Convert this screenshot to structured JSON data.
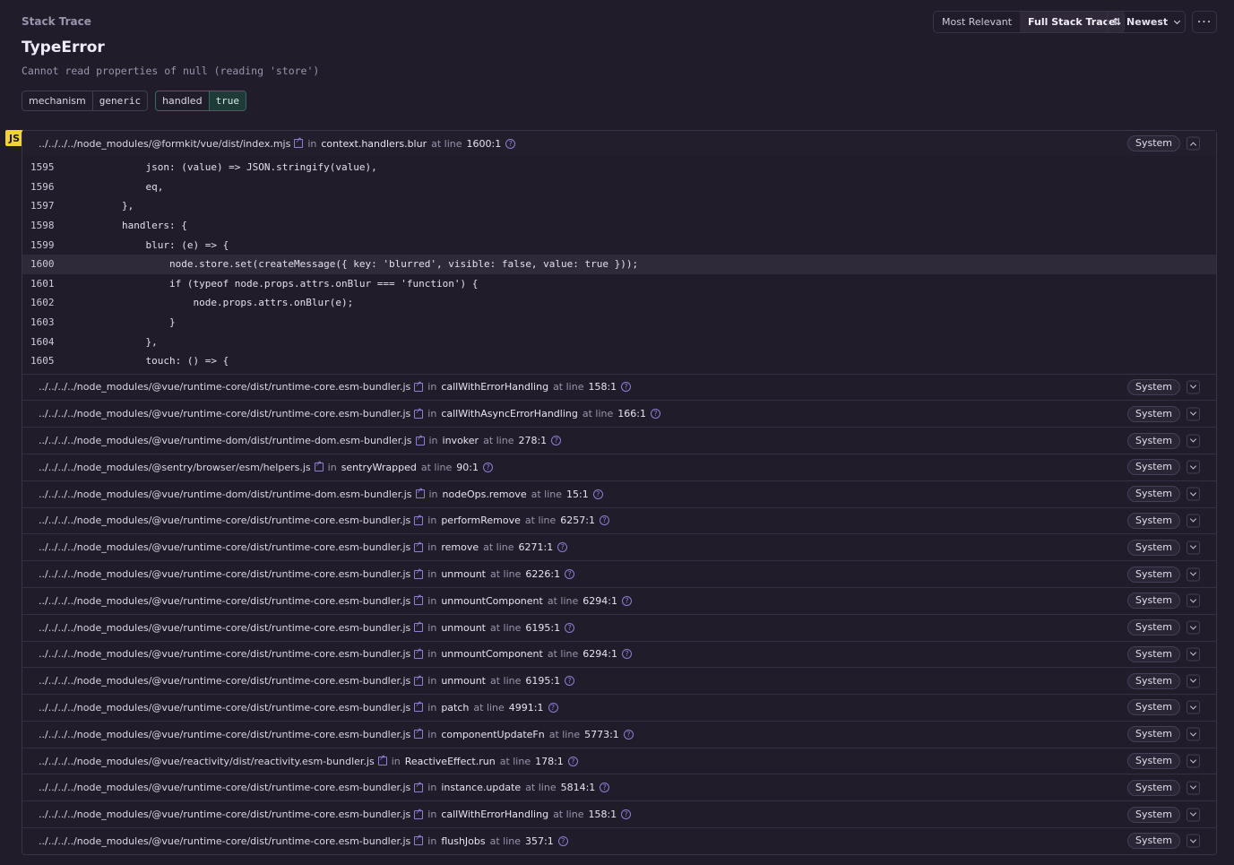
{
  "header": {
    "section_label": "Stack Trace",
    "title": "TypeError",
    "message": "Cannot read properties of null (reading 'store')"
  },
  "tags": [
    {
      "key": "mechanism",
      "value": "generic"
    },
    {
      "key": "handled",
      "value": "true"
    }
  ],
  "controls": {
    "most_relevant": "Most Relevant",
    "full_stack_trace": "Full Stack Trace",
    "sort_label": "Newest",
    "more": "···"
  },
  "platform_badge": "JS",
  "labels": {
    "in": "in",
    "at_line": "at line",
    "system": "System"
  },
  "first_frame": {
    "file": "../../../../node_modules/@formkit/vue/dist/index.mjs",
    "function": "context.handlers.blur",
    "line": "1600:1"
  },
  "code": [
    {
      "num": "1595",
      "text": "            json: (value) => JSON.stringify(value),"
    },
    {
      "num": "1596",
      "text": "            eq,"
    },
    {
      "num": "1597",
      "text": "        },"
    },
    {
      "num": "1598",
      "text": "        handlers: {"
    },
    {
      "num": "1599",
      "text": "            blur: (e) => {"
    },
    {
      "num": "1600",
      "text": "                node.store.set(createMessage({ key: 'blurred', visible: false, value: true }));"
    },
    {
      "num": "1601",
      "text": "                if (typeof node.props.attrs.onBlur === 'function') {"
    },
    {
      "num": "1602",
      "text": "                    node.props.attrs.onBlur(e);"
    },
    {
      "num": "1603",
      "text": "                }"
    },
    {
      "num": "1604",
      "text": "            },"
    },
    {
      "num": "1605",
      "text": "            touch: () => {"
    }
  ],
  "frames": [
    {
      "file": "../../../../node_modules/@vue/runtime-core/dist/runtime-core.esm-bundler.js",
      "function": "callWithErrorHandling",
      "line": "158:1"
    },
    {
      "file": "../../../../node_modules/@vue/runtime-core/dist/runtime-core.esm-bundler.js",
      "function": "callWithAsyncErrorHandling",
      "line": "166:1"
    },
    {
      "file": "../../../../node_modules/@vue/runtime-dom/dist/runtime-dom.esm-bundler.js",
      "function": "invoker",
      "line": "278:1"
    },
    {
      "file": "../../../../node_modules/@sentry/browser/esm/helpers.js",
      "function": "sentryWrapped",
      "line": "90:1"
    },
    {
      "file": "../../../../node_modules/@vue/runtime-dom/dist/runtime-dom.esm-bundler.js",
      "function": "nodeOps.remove",
      "line": "15:1"
    },
    {
      "file": "../../../../node_modules/@vue/runtime-core/dist/runtime-core.esm-bundler.js",
      "function": "performRemove",
      "line": "6257:1"
    },
    {
      "file": "../../../../node_modules/@vue/runtime-core/dist/runtime-core.esm-bundler.js",
      "function": "remove",
      "line": "6271:1"
    },
    {
      "file": "../../../../node_modules/@vue/runtime-core/dist/runtime-core.esm-bundler.js",
      "function": "unmount",
      "line": "6226:1"
    },
    {
      "file": "../../../../node_modules/@vue/runtime-core/dist/runtime-core.esm-bundler.js",
      "function": "unmountComponent",
      "line": "6294:1"
    },
    {
      "file": "../../../../node_modules/@vue/runtime-core/dist/runtime-core.esm-bundler.js",
      "function": "unmount",
      "line": "6195:1"
    },
    {
      "file": "../../../../node_modules/@vue/runtime-core/dist/runtime-core.esm-bundler.js",
      "function": "unmountComponent",
      "line": "6294:1"
    },
    {
      "file": "../../../../node_modules/@vue/runtime-core/dist/runtime-core.esm-bundler.js",
      "function": "unmount",
      "line": "6195:1"
    },
    {
      "file": "../../../../node_modules/@vue/runtime-core/dist/runtime-core.esm-bundler.js",
      "function": "patch",
      "line": "4991:1"
    },
    {
      "file": "../../../../node_modules/@vue/runtime-core/dist/runtime-core.esm-bundler.js",
      "function": "componentUpdateFn",
      "line": "5773:1"
    },
    {
      "file": "../../../../node_modules/@vue/reactivity/dist/reactivity.esm-bundler.js",
      "function": "ReactiveEffect.run",
      "line": "178:1"
    },
    {
      "file": "../../../../node_modules/@vue/runtime-core/dist/runtime-core.esm-bundler.js",
      "function": "instance.update",
      "line": "5814:1"
    },
    {
      "file": "../../../../node_modules/@vue/runtime-core/dist/runtime-core.esm-bundler.js",
      "function": "callWithErrorHandling",
      "line": "158:1"
    },
    {
      "file": "../../../../node_modules/@vue/runtime-core/dist/runtime-core.esm-bundler.js",
      "function": "flushJobs",
      "line": "357:1"
    }
  ]
}
